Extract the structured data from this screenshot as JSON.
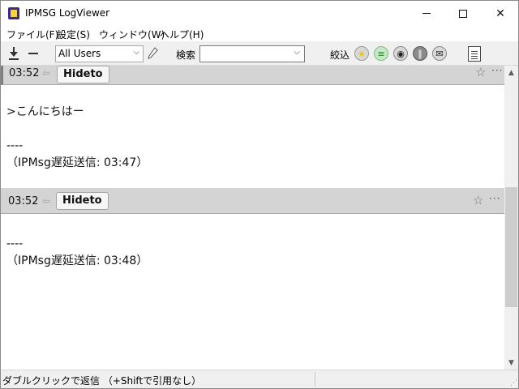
{
  "window": {
    "title": "IPMSG LogViewer",
    "minimize_icon": "minimize-icon",
    "maximize_icon": "maximize-icon",
    "close_glyph": "✕"
  },
  "menu": {
    "items": [
      "ファイル(F)",
      "設定(S)",
      "ウィンドウ(W)",
      "ヘルプ(H)"
    ]
  },
  "toolbar": {
    "user_filter_value": "All Users",
    "search_label": "検索",
    "search_value": "",
    "filter_label": "絞込",
    "filter_icons": [
      "star-icon",
      "memo-icon",
      "camera-icon",
      "clip-icon",
      "mail-icon"
    ]
  },
  "messages": [
    {
      "time": "03:52",
      "sender": "Hideto",
      "body": ">こんにちはー\n\n----\n（IPMsg遅延送信: 03:47）"
    },
    {
      "time": "03:52",
      "sender": "Hideto",
      "body": "----\n（IPMsg遅延送信: 03:48）"
    }
  ],
  "glyphs": {
    "arrow": "⇦",
    "star": "☆",
    "more": "···",
    "chevron": "⌵",
    "scroll_up": "▲",
    "scroll_down": "▼"
  },
  "status": {
    "text": "ダブルクリックで返信 （+Shiftで引用なし）"
  }
}
